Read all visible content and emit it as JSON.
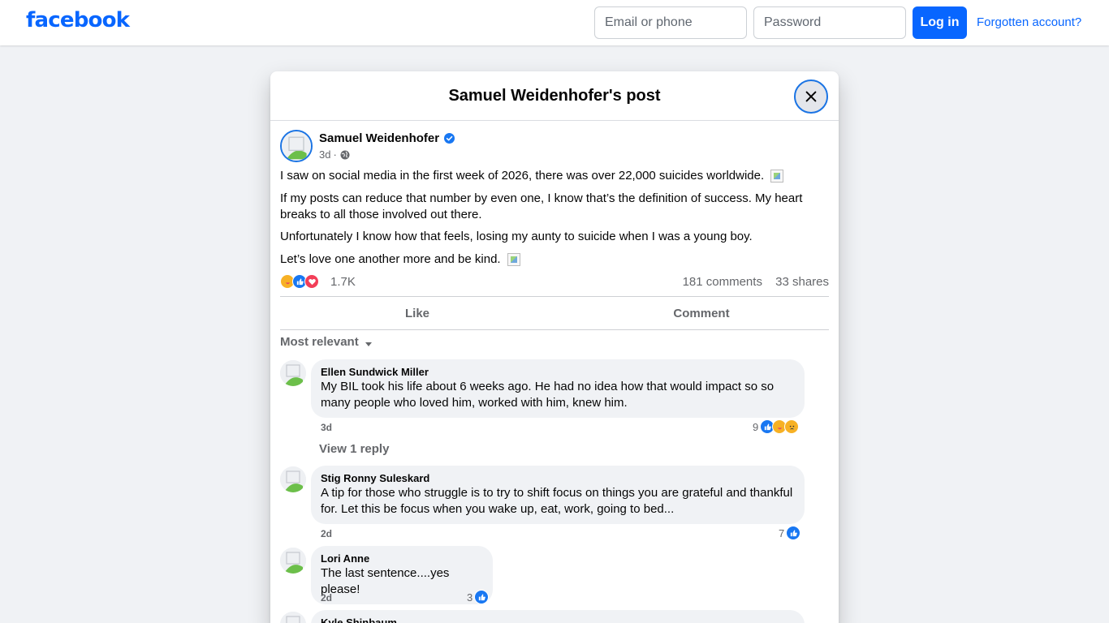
{
  "topbar": {
    "logo": "facebook",
    "email_placeholder": "Email or phone",
    "password_placeholder": "Password",
    "login_label": "Log in",
    "forgot_label": "Forgotten account?"
  },
  "dialog": {
    "title": "Samuel Weidenhofer's post"
  },
  "post": {
    "author": "Samuel Weidenhofer",
    "time": "3d",
    "separator": "·",
    "paragraphs": [
      "I saw on social media in the first week of 2026, there was over 22,000 suicides worldwide.",
      "If my posts can reduce that number by even one, I know that’s the definition of success. My heart breaks to all those involved out there.",
      "Unfortunately I know how that feels, losing my aunty to suicide when I was a young boy.",
      "Let’s love one another more and be kind."
    ],
    "reaction_count": "1.7K",
    "comments_count": "181 comments",
    "shares_count": "33 shares",
    "actions": {
      "like": "Like",
      "comment": "Comment"
    },
    "sort_label": "Most relevant"
  },
  "comments": [
    {
      "name": "Ellen Sundwick Miller",
      "text": "My BIL took his life about 6 weeks ago. He had no idea how that would impact so so many people who loved him, worked with him, knew him.",
      "time": "3d",
      "reactions": "9",
      "reply_link": "View 1 reply"
    },
    {
      "name": "Stig Ronny Suleskard",
      "text": "A tip for those who struggle is to try to shift focus on things you are grateful and thankful for. Let this be focus when you wake up, eat, work, going to bed...",
      "time": "2d",
      "reactions": "7"
    },
    {
      "name": "Lori Anne",
      "text": "The last sentence....yes please!",
      "time": "2d",
      "reactions": "3"
    },
    {
      "name": "Kyle Shinbaum"
    }
  ],
  "colors": {
    "brand": "#0866ff",
    "background": "#f0f2f5",
    "secondary_text": "#65676b"
  }
}
